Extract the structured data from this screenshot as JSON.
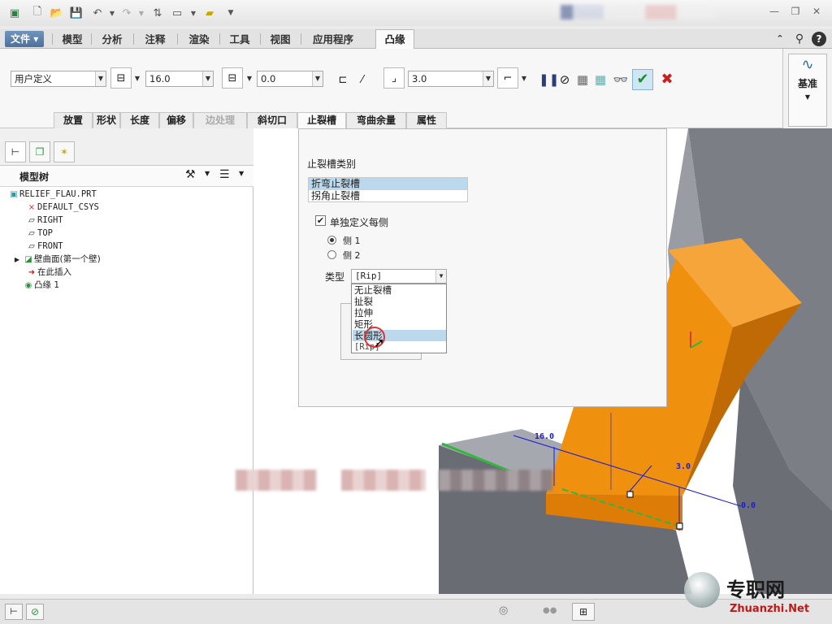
{
  "quick_access": {
    "more": "▼"
  },
  "ribbon_tabs": {
    "file": "文件",
    "tabs": [
      "模型",
      "分析",
      "注释",
      "渲染",
      "工具",
      "视图",
      "应用程序"
    ],
    "active": "凸缘"
  },
  "toolbar": {
    "shape_select": "用户定义",
    "length1_value": "16.0",
    "length2_value": "0.0",
    "radius_value": "3.0",
    "datum_label": "基准"
  },
  "sub_tabs": [
    "放置",
    "形状",
    "长度",
    "偏移",
    "边处理",
    "斜切口",
    "止裂槽",
    "弯曲余量",
    "属性"
  ],
  "model_tree": {
    "title": "模型树",
    "items": [
      {
        "label": "RELIEF_FLAU.PRT",
        "icon": "part-icon"
      },
      {
        "label": "DEFAULT_CSYS",
        "icon": "csys-icon"
      },
      {
        "label": "RIGHT",
        "icon": "plane-icon"
      },
      {
        "label": "TOP",
        "icon": "plane-icon"
      },
      {
        "label": "FRONT",
        "icon": "plane-icon"
      },
      {
        "label": "壁曲面(第一个壁)",
        "icon": "wall-icon"
      },
      {
        "label": "在此插入",
        "icon": "insert-arrow-icon"
      },
      {
        "label": "凸缘 1",
        "icon": "flange-icon"
      }
    ]
  },
  "relief_panel": {
    "title": "止裂槽类别",
    "categories": [
      "折弯止裂槽",
      "拐角止裂槽"
    ],
    "selected_category": "折弯止裂槽",
    "checkbox_label": "单独定义每侧",
    "checkbox_checked": true,
    "side1": "侧 1",
    "side2": "侧 2",
    "type_label": "类型",
    "type_value": "[Rip]",
    "options": [
      "无止裂槽",
      "扯裂",
      "拉伸",
      "矩形",
      "长圆形",
      "[Rip]"
    ],
    "highlighted_option": "长圆形"
  },
  "dimensions": {
    "d1": "16.0",
    "d2": "3.0",
    "d3": "0.0"
  },
  "watermark": {
    "cn": "专职网",
    "en": "Zhuanzhi.Net"
  },
  "colors": {
    "flange": "#f0900f",
    "accent": "#4c719c",
    "selection": "#bcd8ec"
  }
}
